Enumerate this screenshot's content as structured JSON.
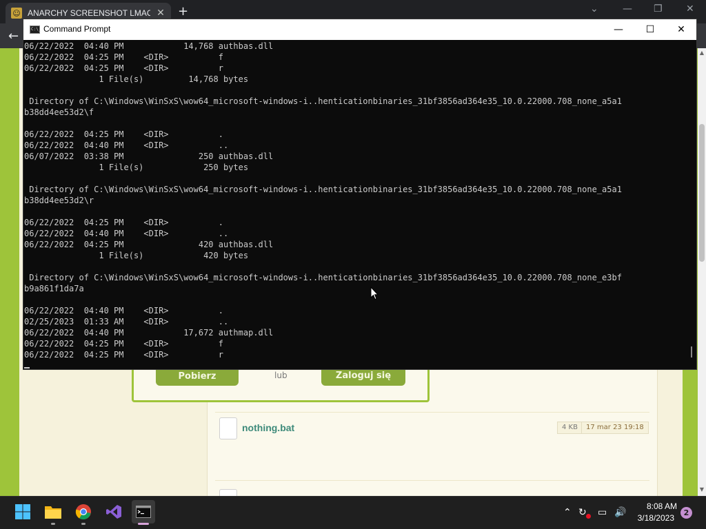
{
  "browser": {
    "tab_title": "ANARCHY SCREENSHOT LMAO -",
    "tab_close": "✕",
    "new_tab": "+",
    "back": "←"
  },
  "webpage": {
    "download_button": "Pobierz",
    "or_text": "lub",
    "login_button": "Zaloguj się",
    "files": [
      {
        "name": "nothing.bat",
        "size": "4 KB",
        "date": "17 mar 23 19:18"
      }
    ]
  },
  "cmd": {
    "title": "Command Prompt",
    "icon_text": "C:\\_",
    "minimize": "—",
    "maximize": "☐",
    "close": "✕",
    "lines": [
      "06/22/2022  04:40 PM            14,768 authbas.dll",
      "06/22/2022  04:25 PM    <DIR>          f",
      "06/22/2022  04:25 PM    <DIR>          r",
      "               1 File(s)         14,768 bytes",
      "",
      " Directory of C:\\Windows\\WinSxS\\wow64_microsoft-windows-i..henticationbinaries_31bf3856ad364e35_10.0.22000.708_none_a5a1",
      "b38dd4ee53d2\\f",
      "",
      "06/22/2022  04:25 PM    <DIR>          .",
      "06/22/2022  04:40 PM    <DIR>          ..",
      "06/07/2022  03:38 PM               250 authbas.dll",
      "               1 File(s)            250 bytes",
      "",
      " Directory of C:\\Windows\\WinSxS\\wow64_microsoft-windows-i..henticationbinaries_31bf3856ad364e35_10.0.22000.708_none_a5a1",
      "b38dd4ee53d2\\r",
      "",
      "06/22/2022  04:25 PM    <DIR>          .",
      "06/22/2022  04:40 PM    <DIR>          ..",
      "06/22/2022  04:25 PM               420 authbas.dll",
      "               1 File(s)            420 bytes",
      "",
      " Directory of C:\\Windows\\WinSxS\\wow64_microsoft-windows-i..henticationbinaries_31bf3856ad364e35_10.0.22000.708_none_e3bf",
      "b9a861f1da7a",
      "",
      "06/22/2022  04:40 PM    <DIR>          .",
      "02/25/2023  01:33 AM    <DIR>          ..",
      "06/22/2022  04:40 PM            17,672 authmap.dll",
      "06/22/2022  04:25 PM    <DIR>          f",
      "06/22/2022  04:25 PM    <DIR>          r"
    ]
  },
  "taskbar": {
    "apps": [
      {
        "name": "start-button"
      },
      {
        "name": "file-explorer"
      },
      {
        "name": "google-chrome"
      },
      {
        "name": "visual-studio"
      },
      {
        "name": "command-prompt",
        "active": true
      }
    ],
    "time": "8:08 AM",
    "date": "3/18/2023",
    "notifications": "2"
  },
  "colors": {
    "console_bg": "#0c0c0c",
    "console_fg": "#cccccc",
    "page_accent": "#9ec43a",
    "link": "#3d8a7a"
  }
}
